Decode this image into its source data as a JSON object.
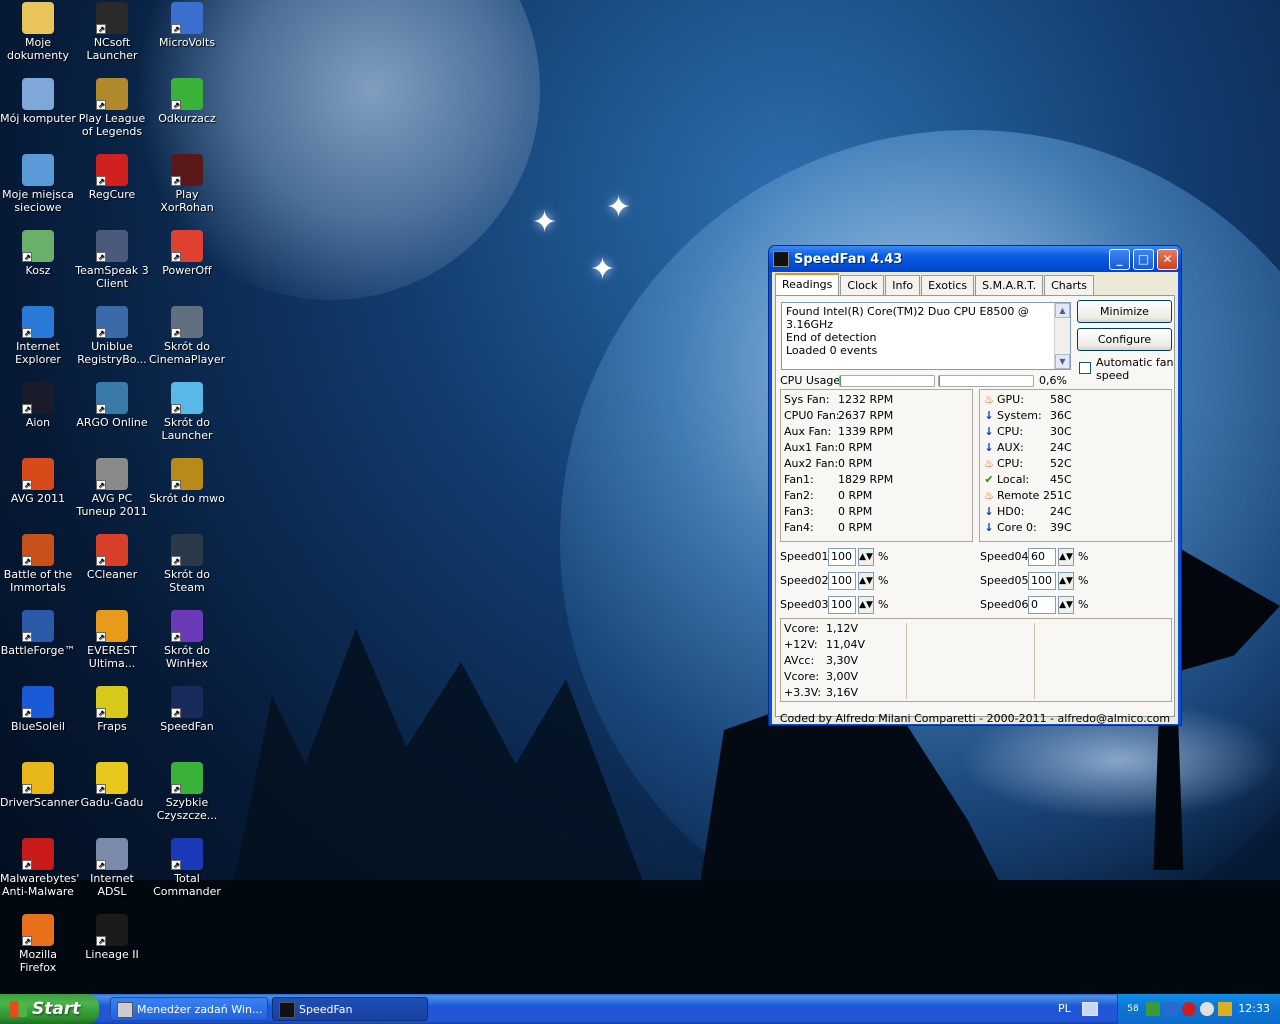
{
  "desktop_icons": [
    {
      "label": "Moje dokumenty",
      "icon": "folder-icon",
      "color": "#e8c45a"
    },
    {
      "label": "NCsoft Launcher",
      "icon": "ncsoft-icon",
      "color": "#2a2a2a"
    },
    {
      "label": "MicroVolts",
      "icon": "microvolts-icon",
      "color": "#3a6fd0"
    },
    {
      "label": "Mój komputer",
      "icon": "computer-icon",
      "color": "#7fa8d8"
    },
    {
      "label": "Play League of Legends",
      "icon": "lol-icon",
      "color": "#b08a2a"
    },
    {
      "label": "Odkurzacz",
      "icon": "cleaner-icon",
      "color": "#3ab23a"
    },
    {
      "label": "Moje miejsca sieciowe",
      "icon": "network-icon",
      "color": "#5a9ad8"
    },
    {
      "label": "RegCure",
      "icon": "regcure-icon",
      "color": "#d02020"
    },
    {
      "label": "Play XorRohan",
      "icon": "rohan-icon",
      "color": "#5a1818"
    },
    {
      "label": "Kosz",
      "icon": "recycle-bin-icon",
      "color": "#6ab06a"
    },
    {
      "label": "TeamSpeak 3 Client",
      "icon": "teamspeak-icon",
      "color": "#4a5a7a"
    },
    {
      "label": "PowerOff",
      "icon": "power-icon",
      "color": "#e04030"
    },
    {
      "label": "Internet Explorer",
      "icon": "ie-icon",
      "color": "#2a7ad8"
    },
    {
      "label": "Uniblue RegistryBo...",
      "icon": "uniblue-icon",
      "color": "#3a6aa8"
    },
    {
      "label": "Skrót do CinemaPlayer",
      "icon": "film-icon",
      "color": "#607080"
    },
    {
      "label": "Aion",
      "icon": "aion-icon",
      "color": "#1a1a2a"
    },
    {
      "label": "ARGO Online",
      "icon": "argo-icon",
      "color": "#3a7aa8"
    },
    {
      "label": "Skrót do Launcher",
      "icon": "launcher-icon",
      "color": "#5ab8e8"
    },
    {
      "label": "AVG 2011",
      "icon": "avg-icon",
      "color": "#d84a1a"
    },
    {
      "label": "AVG PC Tuneup 2011",
      "icon": "tuneup-icon",
      "color": "#8a8a8a"
    },
    {
      "label": "Skrót do mwo",
      "icon": "mwo-icon",
      "color": "#b88a1a"
    },
    {
      "label": "Battle of the Immortals",
      "icon": "boi-icon",
      "color": "#c8501a"
    },
    {
      "label": "CCleaner",
      "icon": "ccleaner-icon",
      "color": "#d8402a"
    },
    {
      "label": "Skrót do Steam",
      "icon": "steam-icon",
      "color": "#2a3a4a"
    },
    {
      "label": "BattleForge™",
      "icon": "battleforge-icon",
      "color": "#2a5aa8"
    },
    {
      "label": "EVEREST Ultima...",
      "icon": "everest-icon",
      "color": "#e89a1a"
    },
    {
      "label": "Skrót do WinHex",
      "icon": "winhex-icon",
      "color": "#6a3ab8"
    },
    {
      "label": "BlueSoleil",
      "icon": "bluetooth-icon",
      "color": "#1a5ad8"
    },
    {
      "label": "Fraps",
      "icon": "fraps-icon",
      "color": "#d8c81a"
    },
    {
      "label": "SpeedFan",
      "icon": "speedfan-icon",
      "color": "#1a2a5a"
    },
    {
      "label": "DriverScanner",
      "icon": "driverscanner-icon",
      "color": "#e8b81a"
    },
    {
      "label": "Gadu-Gadu",
      "icon": "gadugadu-icon",
      "color": "#e8c81a"
    },
    {
      "label": "Szybkie Czyszcze...",
      "icon": "quickclean-icon",
      "color": "#3ab23a"
    },
    {
      "label": "Malwarebytes' Anti-Malware",
      "icon": "malwarebytes-icon",
      "color": "#c81a1a"
    },
    {
      "label": "Internet ADSL",
      "icon": "adsl-icon",
      "color": "#7a8aa8"
    },
    {
      "label": "Total Commander",
      "icon": "totalcommander-icon",
      "color": "#1a3ab8"
    },
    {
      "label": "Mozilla Firefox",
      "icon": "firefox-icon",
      "color": "#e8701a"
    },
    {
      "label": "Lineage II",
      "icon": "lineage-icon",
      "color": "#1a1a1a"
    }
  ],
  "speedfan": {
    "title": "SpeedFan 4.43",
    "tabs": [
      "Readings",
      "Clock",
      "Info",
      "Exotics",
      "S.M.A.R.T.",
      "Charts"
    ],
    "active_tab": "Readings",
    "log_lines": [
      "Found Intel(R) Core(TM)2 Duo CPU E8500 @ 3.16GHz",
      "End of detection",
      "Loaded 0 events"
    ],
    "minimize_label": "Minimize",
    "configure_label": "Configure",
    "auto_fan_label": "Automatic fan speed",
    "auto_fan_checked": false,
    "cpu_usage_label": "CPU Usage",
    "cpu_usage_value": "0,6%",
    "fans": [
      {
        "name": "Sys Fan:",
        "value": "1232 RPM"
      },
      {
        "name": "CPU0 Fan:",
        "value": "2637 RPM"
      },
      {
        "name": "Aux Fan:",
        "value": "1339 RPM"
      },
      {
        "name": "Aux1 Fan:",
        "value": "0 RPM"
      },
      {
        "name": "Aux2 Fan:",
        "value": "0 RPM"
      },
      {
        "name": "Fan1:",
        "value": "1829 RPM"
      },
      {
        "name": "Fan2:",
        "value": "0 RPM"
      },
      {
        "name": "Fan3:",
        "value": "0 RPM"
      },
      {
        "name": "Fan4:",
        "value": "0 RPM"
      }
    ],
    "temps": [
      {
        "name": "GPU:",
        "value": "58C",
        "status": "fire"
      },
      {
        "name": "System:",
        "value": "36C",
        "status": "down"
      },
      {
        "name": "CPU:",
        "value": "30C",
        "status": "down"
      },
      {
        "name": "AUX:",
        "value": "24C",
        "status": "down"
      },
      {
        "name": "CPU:",
        "value": "52C",
        "status": "fire"
      },
      {
        "name": "Local:",
        "value": "45C",
        "status": "ok"
      },
      {
        "name": "Remote 2:",
        "value": "51C",
        "status": "fire"
      },
      {
        "name": "HD0:",
        "value": "24C",
        "status": "down"
      },
      {
        "name": "Core 0:",
        "value": "39C",
        "status": "down"
      }
    ],
    "speeds": [
      {
        "name": "Speed01:",
        "value": "100"
      },
      {
        "name": "Speed02:",
        "value": "100"
      },
      {
        "name": "Speed03:",
        "value": "100"
      },
      {
        "name": "Speed04:",
        "value": "60"
      },
      {
        "name": "Speed05:",
        "value": "100"
      },
      {
        "name": "Speed06:",
        "value": "0"
      }
    ],
    "percent_sign": "%",
    "voltages": [
      {
        "name": "Vcore:",
        "value": "1,12V"
      },
      {
        "name": "+12V:",
        "value": "11,04V"
      },
      {
        "name": "AVcc:",
        "value": "3,30V"
      },
      {
        "name": "Vcore:",
        "value": "3,00V"
      },
      {
        "name": "+3.3V:",
        "value": "3,16V"
      }
    ],
    "footer": "Coded by Alfredo Milani Comparetti - 2000-2011 - alfredo@almico.com"
  },
  "taskbar": {
    "start_label": "Start",
    "tasks": [
      {
        "label": "Menedżer zadań Win...",
        "active": false
      },
      {
        "label": "SpeedFan",
        "active": true
      }
    ],
    "language": "PL",
    "tray_temp": "58",
    "clock": "12:33"
  }
}
